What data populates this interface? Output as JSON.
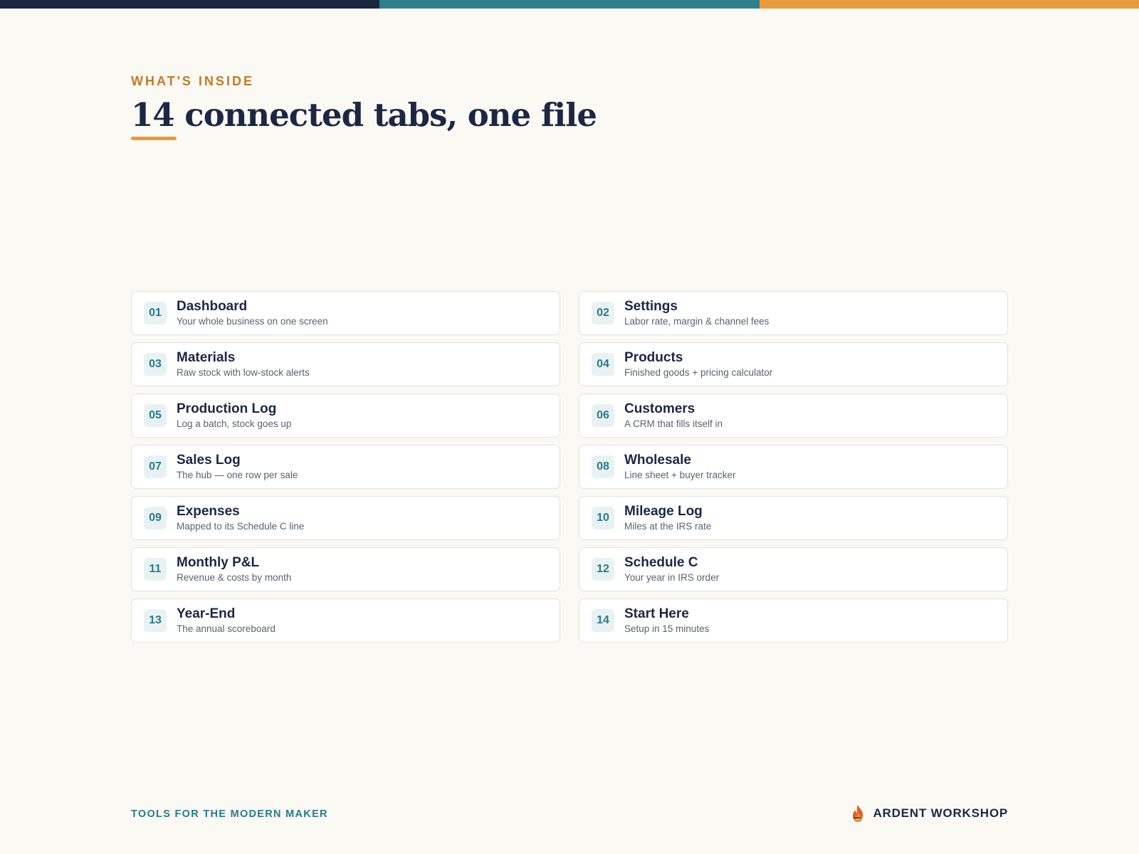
{
  "colors": {
    "navy": "#1c2744",
    "teal": "#2e7f8c",
    "orange": "#e89a3c",
    "eyebrow": "#c27a28",
    "background": "#faf9f4"
  },
  "header": {
    "eyebrow": "WHAT'S INSIDE",
    "headline": "14 connected tabs, one file"
  },
  "tabs": [
    {
      "num": "01",
      "title": "Dashboard",
      "desc": "Your whole business on one screen"
    },
    {
      "num": "02",
      "title": "Settings",
      "desc": "Labor rate, margin & channel fees"
    },
    {
      "num": "03",
      "title": "Materials",
      "desc": "Raw stock with low-stock alerts"
    },
    {
      "num": "04",
      "title": "Products",
      "desc": "Finished goods + pricing calculator"
    },
    {
      "num": "05",
      "title": "Production Log",
      "desc": "Log a batch, stock goes up"
    },
    {
      "num": "06",
      "title": "Customers",
      "desc": "A CRM that fills itself in"
    },
    {
      "num": "07",
      "title": "Sales Log",
      "desc": "The hub — one row per sale"
    },
    {
      "num": "08",
      "title": "Wholesale",
      "desc": "Line sheet + buyer tracker"
    },
    {
      "num": "09",
      "title": "Expenses",
      "desc": "Mapped to its Schedule C line"
    },
    {
      "num": "10",
      "title": "Mileage Log",
      "desc": "Miles at the IRS rate"
    },
    {
      "num": "11",
      "title": "Monthly P&L",
      "desc": "Revenue & costs by month"
    },
    {
      "num": "12",
      "title": "Schedule C",
      "desc": "Your year in IRS order"
    },
    {
      "num": "13",
      "title": "Year-End",
      "desc": "The annual scoreboard"
    },
    {
      "num": "14",
      "title": "Start Here",
      "desc": "Setup in 15 minutes"
    }
  ],
  "footer": {
    "tagline": "TOOLS FOR THE MODERN MAKER",
    "brand": "ARDENT WORKSHOP",
    "brand_icon": "flame-icon"
  }
}
